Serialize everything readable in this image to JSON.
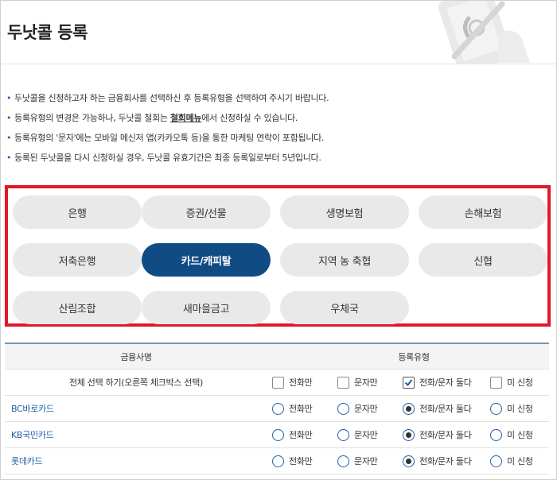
{
  "page": {
    "title": "두낫콜 등록"
  },
  "notices": {
    "n1": "두낫콜을 신청하고자 하는 금융회사를 선택하신 후 등록유형을 선택하여 주시기 바랍니다.",
    "n2_pre": "등록유형의 변경은 가능하나, 두낫콜 철회는 ",
    "n2_link": "철회메뉴",
    "n2_post": "에서 신청하실 수 있습니다.",
    "n3": "등록유형의 '문자'에는 모바일 메신저 앱(카카오톡 등)을 통한 마케팅 연락이 포함됩니다.",
    "n4": "등록된 두낫콜을 다시 신청하실 경우, 두낫콜 유효기간은 최종 등록일로부터 5년입니다."
  },
  "categories": [
    "은행",
    "증권/선물",
    "생명보험",
    "손해보험",
    "저축은행",
    "카드/캐피탈",
    "지역 농 축협",
    "신협",
    "산림조합",
    "새마을금고",
    "우체국"
  ],
  "active_category": "카드/캐피탈",
  "table": {
    "headers": [
      "금융사명",
      "등록유형"
    ],
    "select_all_label": "전체 선택 하기(오른쪽 체크박스 선택)",
    "options": [
      "전화만",
      "문자만",
      "전화/문자 둘다",
      "미 신청"
    ],
    "select_all_checked": "전화/문자 둘다",
    "rows": [
      {
        "name": "BC바로카드",
        "selected": "전화/문자 둘다"
      },
      {
        "name": "KB국민카드",
        "selected": "전화/문자 둘다"
      },
      {
        "name": "롯데카드",
        "selected": "전화/문자 둘다"
      }
    ]
  },
  "colors": {
    "accent": "#104b84",
    "highlight_border": "#e0182a",
    "link": "#1f5fa8"
  }
}
